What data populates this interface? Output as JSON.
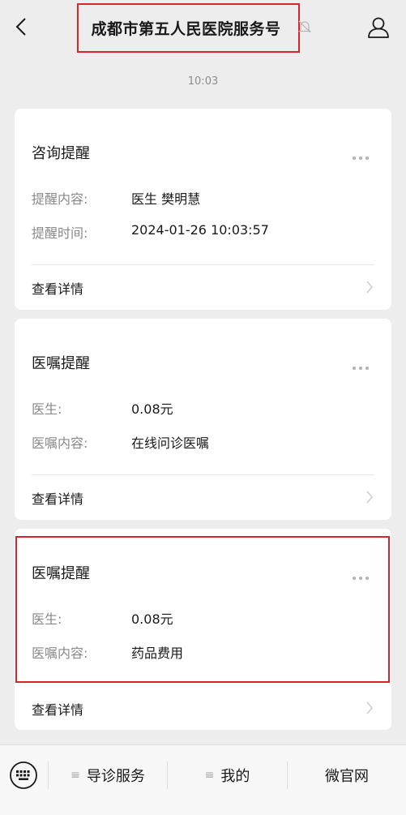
{
  "header": {
    "title": "成都市第五人民医院服务号",
    "back_icon": "chevron-left-icon",
    "bell_icon": "bell-muted-icon",
    "profile_icon": "person-icon"
  },
  "timestamp": "10:03",
  "cards": [
    {
      "title": "咨询提醒",
      "rows": [
        {
          "label": "提醒内容:",
          "value": "医生 樊明慧"
        },
        {
          "label": "提醒时间:",
          "value": "2024-01-26 10:03:57"
        }
      ],
      "detail": "查看详情"
    },
    {
      "title": "医嘱提醒",
      "rows": [
        {
          "label": "医生:",
          "value": "0.08元"
        },
        {
          "label": "医嘱内容:",
          "value": "在线问诊医嘱"
        }
      ],
      "detail": "查看详情"
    },
    {
      "title": "医嘱提醒",
      "rows": [
        {
          "label": "医生:",
          "value": "0.08元"
        },
        {
          "label": "医嘱内容:",
          "value": "药品费用"
        }
      ],
      "detail": "查看详情"
    }
  ],
  "bottom_menu": {
    "keyboard_icon": "keyboard-icon",
    "items": [
      {
        "label": "导诊服务",
        "lines": "≡"
      },
      {
        "label": "我的",
        "lines": "≡"
      },
      {
        "label": "微官网",
        "lines": ""
      }
    ]
  },
  "colors": {
    "background": "#ededed",
    "card": "#ffffff",
    "highlight": "#d9232d",
    "label": "#8a8a8a"
  }
}
